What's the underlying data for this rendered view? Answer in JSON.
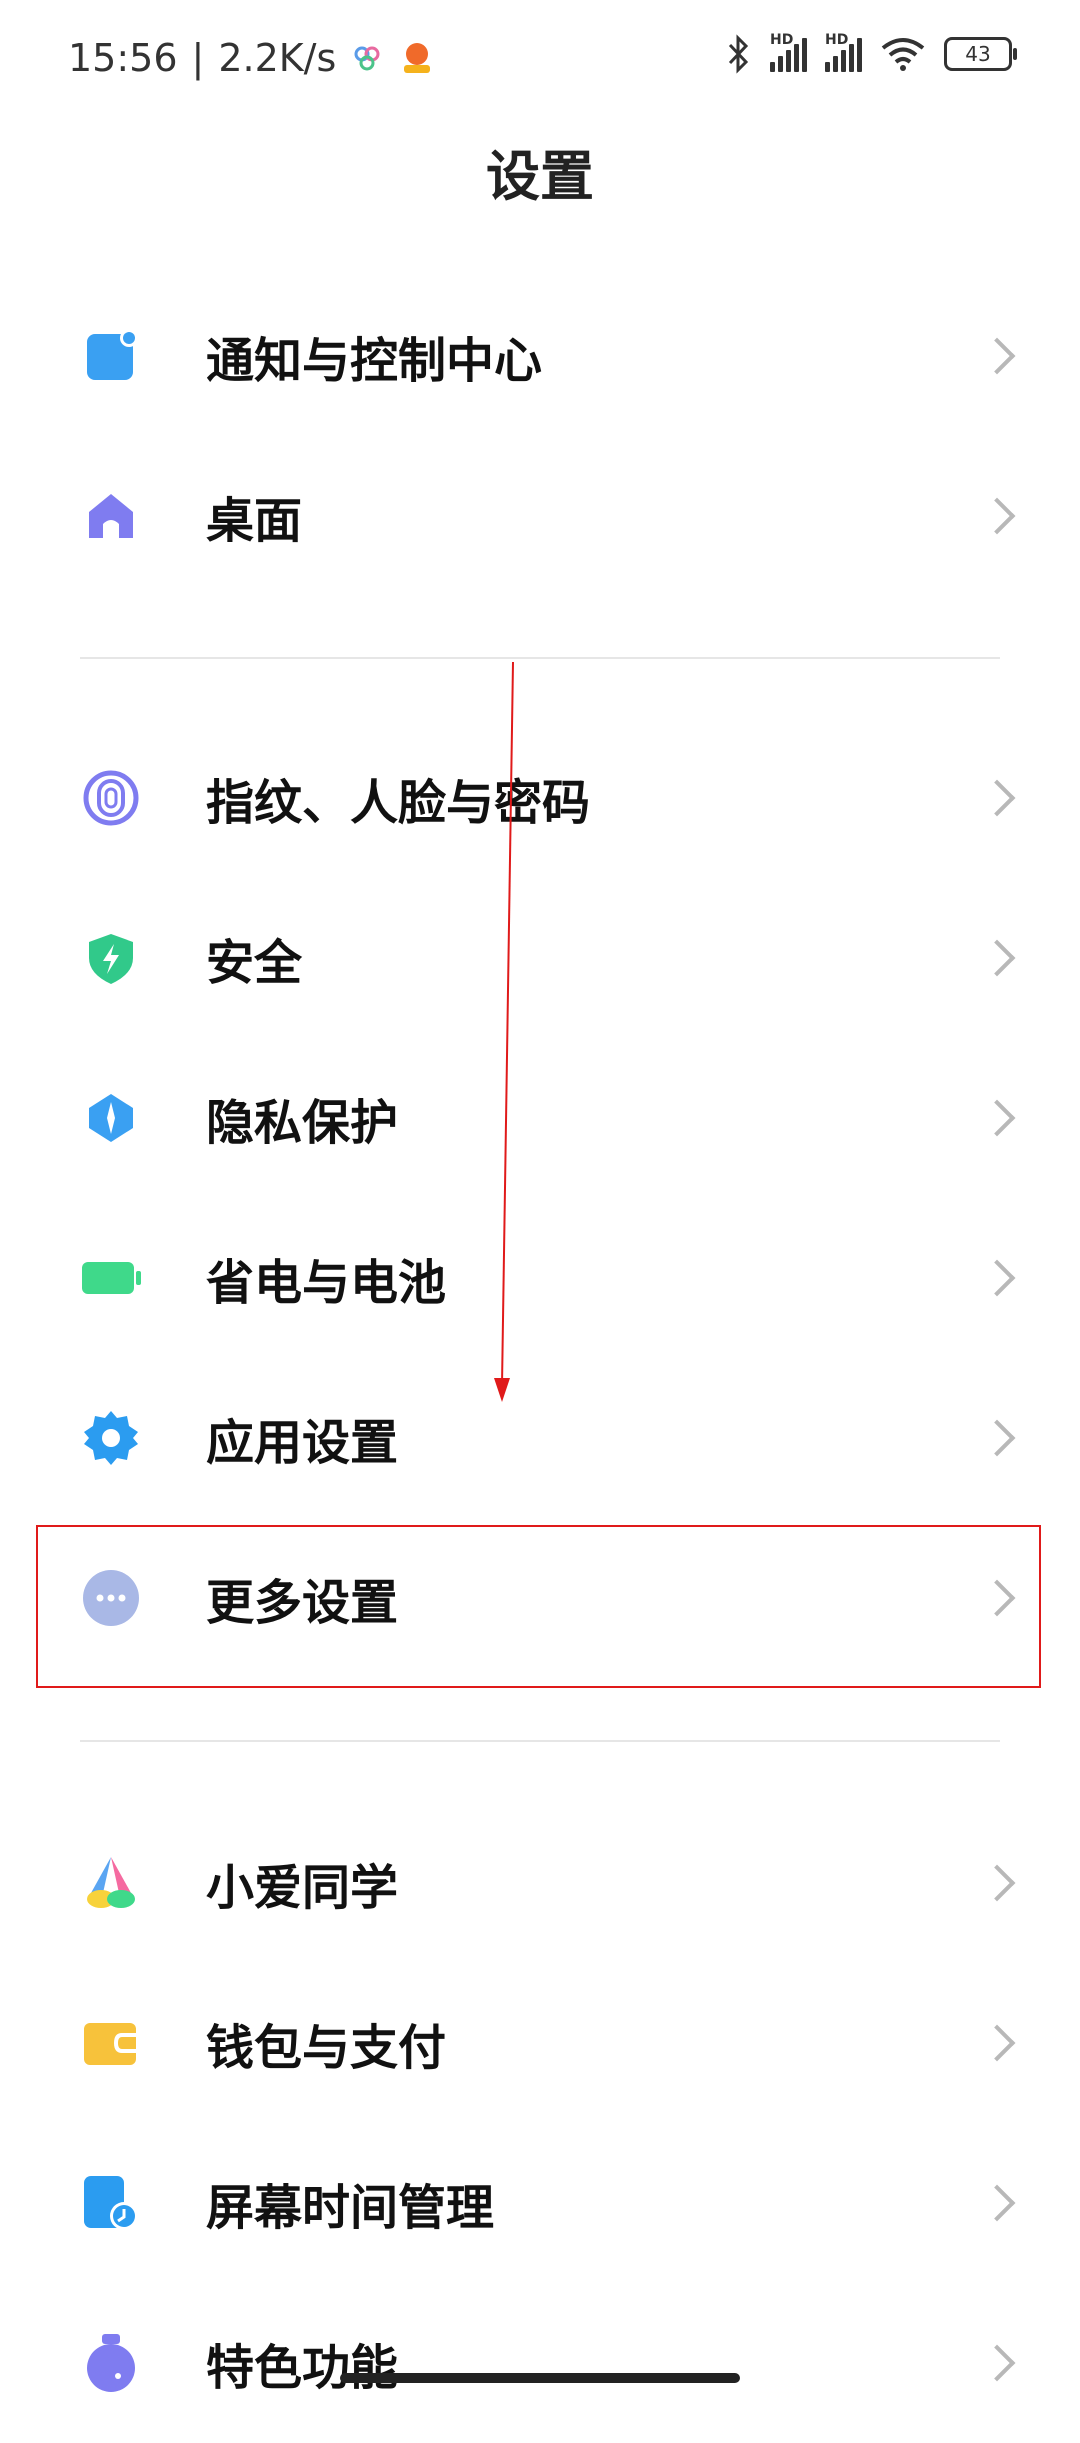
{
  "status": {
    "time": "15:56",
    "separator": "|",
    "speed": "2.2K/s",
    "battery": "43",
    "hd1": "HD",
    "hd2": "HD"
  },
  "header": {
    "title": "设置"
  },
  "groups": [
    {
      "items": [
        {
          "label": "通知与控制中心",
          "icon": "notification-icon",
          "color": "#3aa0f2"
        },
        {
          "label": "桌面",
          "icon": "home-icon",
          "color": "#7f7cf0"
        }
      ]
    },
    {
      "items": [
        {
          "label": "指纹、人脸与密码",
          "icon": "fingerprint-icon",
          "color": "#7f7cf0"
        },
        {
          "label": "安全",
          "icon": "shield-icon",
          "color": "#31c98a"
        },
        {
          "label": "隐私保护",
          "icon": "privacy-icon",
          "color": "#3aa0f2"
        },
        {
          "label": "省电与电池",
          "icon": "battery-icon",
          "color": "#3fd98a"
        },
        {
          "label": "应用设置",
          "icon": "gear-icon",
          "color": "#2b9cf0"
        },
        {
          "label": "更多设置",
          "icon": "more-icon",
          "color": "#a9b8e6"
        }
      ]
    },
    {
      "items": [
        {
          "label": "小爱同学",
          "icon": "xiaoai-icon",
          "color": "#f56aa0"
        },
        {
          "label": "钱包与支付",
          "icon": "wallet-icon",
          "color": "#f7c23b"
        },
        {
          "label": "屏幕时间管理",
          "icon": "screen-time-icon",
          "color": "#2b9cf0"
        },
        {
          "label": "特色功能",
          "icon": "potion-icon",
          "color": "#7f7cf0"
        }
      ]
    }
  ],
  "annotations": {
    "highlight_color": "#e01a1a",
    "arrow_color": "#e01a1a"
  }
}
